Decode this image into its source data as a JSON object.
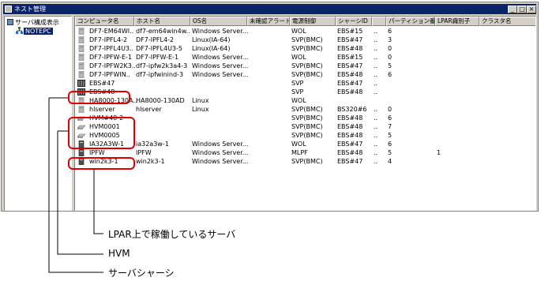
{
  "window": {
    "title": "ネスト管理"
  },
  "tree": {
    "root_label": "サーバ構成表示",
    "node_label": "NOTEPC"
  },
  "columns": [
    "コンピュータ名",
    "ホスト名",
    "OS名",
    "未確認アラート",
    "電源制御",
    "シャーシID",
    "",
    "パーティション番号",
    "LPAR識別子",
    "クラスタ名"
  ],
  "rows": [
    {
      "icon": "server-gray",
      "name": "DF7-EM64WI..",
      "host": "df7-em64win4w..",
      "os": "Windows Server...",
      "power": "WOL",
      "chassis": "EBS#15",
      "dots": "..",
      "part": "6",
      "lpar": ""
    },
    {
      "icon": "server-gray",
      "name": "DF7-IPFL4-2",
      "host": "DF7-IPFL4-2",
      "os": "Linux(IA-64)",
      "power": "SVP(BMC)",
      "chassis": "EBS#47",
      "dots": "..",
      "part": "3",
      "lpar": ""
    },
    {
      "icon": "server-gray",
      "name": "DF7-IPFL4U3..",
      "host": "DF7-IPFL4U3-5",
      "os": "Linux(IA-64)",
      "power": "SVP(BMC)",
      "chassis": "EBS#48",
      "dots": "..",
      "part": "0",
      "lpar": ""
    },
    {
      "icon": "server-gray",
      "name": "DF7-IPFW-E-1",
      "host": "DF7-IPFW-E-1",
      "os": "Windows Server...",
      "power": "WOL",
      "chassis": "EBS#15",
      "dots": "..",
      "part": "0",
      "lpar": ""
    },
    {
      "icon": "server-gray",
      "name": "DF7-IPFW2K3..",
      "host": "df7-ipfw2k3a4-3",
      "os": "Windows Server...",
      "power": "SVP(BMC)",
      "chassis": "EBS#47",
      "dots": "..",
      "part": "5",
      "lpar": ""
    },
    {
      "icon": "server-gray",
      "name": "DF7-IPFWIN..",
      "host": "df7-ipfwinind-3",
      "os": "Windows Server...",
      "power": "SVP(BMC)",
      "chassis": "EBS#48",
      "dots": "..",
      "part": "6",
      "lpar": ""
    },
    {
      "icon": "chassis",
      "name": "EBS#47",
      "host": "",
      "os": "",
      "power": "SVP",
      "chassis": "EBS#47",
      "dots": "..",
      "part": "",
      "lpar": ""
    },
    {
      "icon": "chassis",
      "name": "EBS#48",
      "host": "",
      "os": "",
      "power": "SVP",
      "chassis": "EBS#48",
      "dots": "..",
      "part": "",
      "lpar": ""
    },
    {
      "icon": "server-gray",
      "name": "HA8000-130A..",
      "host": "HA8000-130AD",
      "os": "Linux",
      "power": "WOL",
      "chassis": "",
      "dots": "",
      "part": "",
      "lpar": ""
    },
    {
      "icon": "server-gray",
      "name": "hlserver",
      "host": "hlserver",
      "os": "Linux",
      "power": "SVP(BMC)",
      "chassis": "BS320#6",
      "dots": "..",
      "part": "0",
      "lpar": ""
    },
    {
      "icon": "hvm",
      "name": "HVM#48-2",
      "host": "",
      "os": "",
      "power": "SVP(BMC)",
      "chassis": "EBS#48",
      "dots": "..",
      "part": "6",
      "lpar": ""
    },
    {
      "icon": "hvm",
      "name": "HVM0001",
      "host": "",
      "os": "",
      "power": "SVP(BMC)",
      "chassis": "EBS#48",
      "dots": "..",
      "part": "7",
      "lpar": ""
    },
    {
      "icon": "hvm",
      "name": "HVM0005",
      "host": "",
      "os": "",
      "power": "SVP(BMC)",
      "chassis": "EBS#48",
      "dots": "..",
      "part": "5",
      "lpar": ""
    },
    {
      "icon": "server-dark",
      "name": "IA32A3W-1",
      "host": "ia32a3w-1",
      "os": "Windows Server...",
      "power": "WOL",
      "chassis": "EBS#47",
      "dots": "..",
      "part": "6",
      "lpar": ""
    },
    {
      "icon": "server-dark",
      "name": "IPFW",
      "host": "IPFW",
      "os": "Windows Server...",
      "power": "MLPF",
      "chassis": "EBS#48",
      "dots": "..",
      "part": "5",
      "lpar": "1"
    },
    {
      "icon": "server-dark",
      "name": "win2k3-1",
      "host": "win2k3-1",
      "os": "Windows Server...",
      "power": "SVP(BMC)",
      "chassis": "EBS#47",
      "dots": "..",
      "part": "4",
      "lpar": ""
    }
  ],
  "callouts": {
    "lpar": "LPAR上で稼働しているサーバ",
    "hvm": "HVM",
    "chassis": "サーバシャーシ"
  }
}
